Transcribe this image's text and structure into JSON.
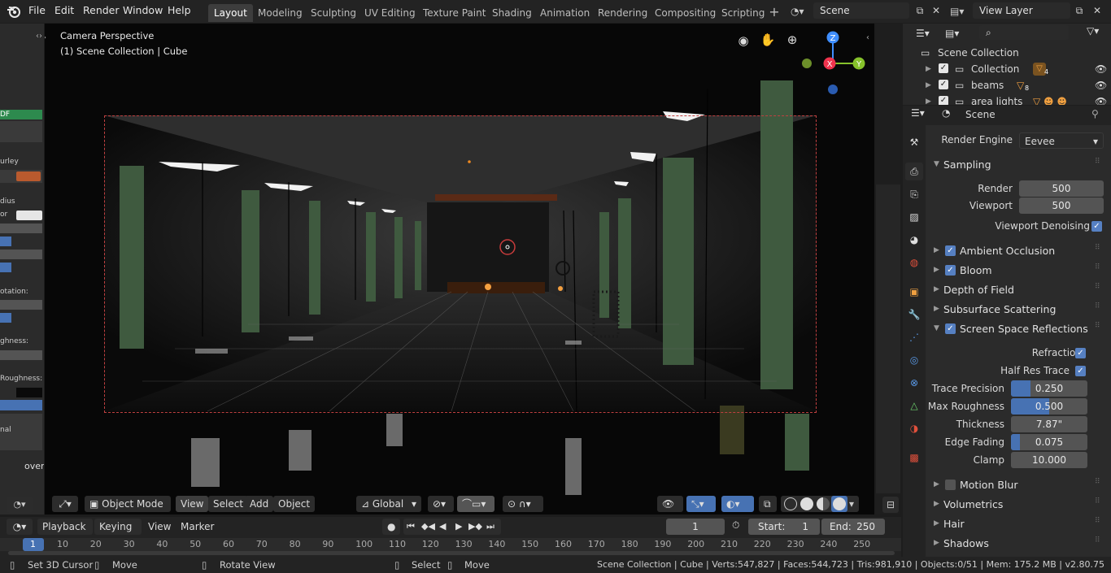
{
  "menus": [
    "File",
    "Edit",
    "Render",
    "Window",
    "Help"
  ],
  "workspaces": [
    "Layout",
    "Modeling",
    "Sculpting",
    "UV Editing",
    "Texture Paint",
    "Shading",
    "Animation",
    "Rendering",
    "Compositing",
    "Scripting"
  ],
  "scene_field": "Scene",
  "view_layer_field": "View Layer",
  "viewport": {
    "title": "Camera Perspective",
    "subtitle": "(1) Scene Collection | Cube",
    "gizmo": {
      "z": "Z",
      "x": "X",
      "y": "Y"
    },
    "header": {
      "mode": "Object Mode",
      "view": "View",
      "select": "Select",
      "add": "Add",
      "object": "Object",
      "transform": "Global"
    }
  },
  "left_panel": {
    "labels": [
      "DF",
      "urley",
      "dius",
      "or",
      "otation:",
      "ghness:",
      "Roughness:",
      "nal",
      "over"
    ]
  },
  "outliner": {
    "root": "Scene Collection",
    "items": [
      {
        "name": "Collection",
        "badge": "4"
      },
      {
        "name": "beams",
        "badge": "8"
      },
      {
        "name": "area lights",
        "badge": ""
      }
    ]
  },
  "properties": {
    "context": "Scene",
    "render_engine_label": "Render Engine",
    "render_engine": "Eevee",
    "sampling": {
      "title": "Sampling",
      "render_label": "Render",
      "render": "500",
      "viewport_label": "Viewport",
      "viewport": "500",
      "denoise_label": "Viewport Denoising"
    },
    "sections": [
      {
        "title": "Ambient Occlusion",
        "checkbox": true
      },
      {
        "title": "Bloom",
        "checkbox": true
      },
      {
        "title": "Depth of Field",
        "checkbox": null
      },
      {
        "title": "Subsurface Scattering",
        "checkbox": null
      }
    ],
    "ssr": {
      "title": "Screen Space Reflections",
      "refraction": "Refraction",
      "half_res": "Half Res Trace",
      "trace_precision_label": "Trace Precision",
      "trace_precision": "0.250",
      "trace_precision_fill": 0.25,
      "max_roughness_label": "Max Roughness",
      "max_roughness": "0.500",
      "max_roughness_fill": 0.5,
      "thickness_label": "Thickness",
      "thickness": "7.87\"",
      "edge_fading_label": "Edge Fading",
      "edge_fading": "0.075",
      "edge_fading_fill": 0.075,
      "clamp_label": "Clamp",
      "clamp": "10.000"
    },
    "sections_after": [
      {
        "title": "Motion Blur",
        "checkbox": false
      },
      {
        "title": "Volumetrics",
        "checkbox": null
      },
      {
        "title": "Hair",
        "checkbox": null
      },
      {
        "title": "Shadows",
        "checkbox": null
      }
    ]
  },
  "timeline": {
    "menus": [
      "Playback",
      "Keying",
      "View",
      "Marker"
    ],
    "current_frame": "1",
    "start_label": "Start:",
    "start": "1",
    "end_label": "End:",
    "end": "250",
    "ticks": [
      "1",
      "10",
      "20",
      "30",
      "40",
      "50",
      "60",
      "70",
      "80",
      "90",
      "100",
      "110",
      "120",
      "130",
      "140",
      "150",
      "160",
      "170",
      "180",
      "190",
      "200",
      "210",
      "220",
      "230",
      "240",
      "250"
    ]
  },
  "statusbar": {
    "set_cursor": "Set 3D Cursor",
    "move": "Move",
    "rotate": "Rotate View",
    "select": "Select",
    "move2": "Move",
    "info": "Scene Collection | Cube | Verts:547,827 | Faces:544,723 | Tris:981,910 | Objects:0/51 | Mem: 175.2 MB | v2.80.75"
  },
  "colors": {
    "accent": "#4772b3",
    "camera_frame": "#c04040",
    "x_axis": "#f0334d",
    "y_axis": "#86c22b",
    "z_axis": "#3f8efe"
  }
}
